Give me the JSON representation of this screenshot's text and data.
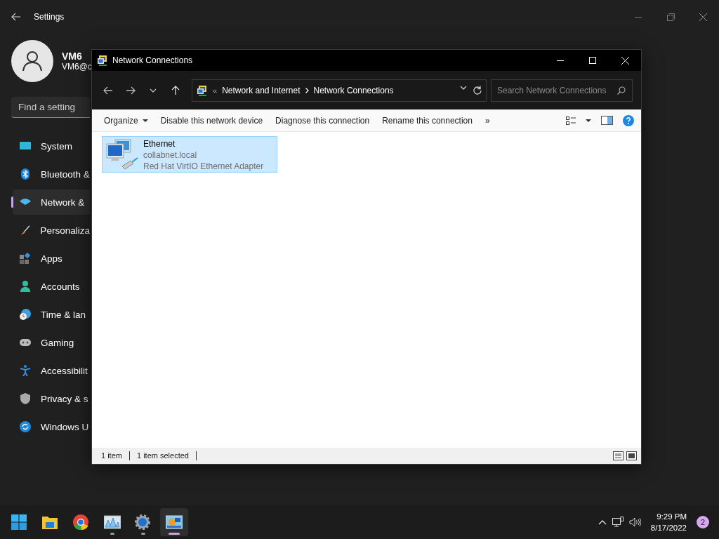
{
  "settings": {
    "title": "Settings",
    "user": {
      "name": "VM6",
      "email": "VM6@c"
    },
    "search": {
      "placeholder": "Find a setting"
    },
    "nav": [
      {
        "label": "System",
        "selected": false
      },
      {
        "label": "Bluetooth &",
        "selected": false
      },
      {
        "label": "Network &",
        "selected": true
      },
      {
        "label": "Personaliza",
        "selected": false
      },
      {
        "label": "Apps",
        "selected": false
      },
      {
        "label": "Accounts",
        "selected": false
      },
      {
        "label": "Time & lan",
        "selected": false
      },
      {
        "label": "Gaming",
        "selected": false
      },
      {
        "label": "Accessibilit",
        "selected": false
      },
      {
        "label": "Privacy & s",
        "selected": false
      },
      {
        "label": "Windows U",
        "selected": false
      }
    ]
  },
  "explorer": {
    "title": "Network Connections",
    "breadcrumb": {
      "overflow": "«",
      "path": [
        "Network and Internet",
        "Network Connections"
      ]
    },
    "search": {
      "placeholder": "Search Network Connections"
    },
    "commands": [
      {
        "label": "Organize",
        "dropdown": true
      },
      {
        "label": "Disable this network device",
        "dropdown": false
      },
      {
        "label": "Diagnose this connection",
        "dropdown": false
      },
      {
        "label": "Rename this connection",
        "dropdown": false
      }
    ],
    "more": "»",
    "items": [
      {
        "name": "Ethernet",
        "status": "collabnet.local",
        "device": "Red Hat VirtIO Ethernet Adapter",
        "selected": true
      }
    ],
    "status_bar": {
      "count": "1 item",
      "selection": "1 item selected"
    }
  },
  "taskbar": {
    "apps": [
      {
        "running": false,
        "active": false
      },
      {
        "running": false,
        "active": false
      },
      {
        "running": false,
        "active": false
      },
      {
        "running": true,
        "active": false
      },
      {
        "running": true,
        "active": false
      },
      {
        "running": true,
        "active": true
      }
    ],
    "clock": {
      "time": "9:29 PM",
      "date": "8/17/2022"
    },
    "notifications": "2"
  }
}
